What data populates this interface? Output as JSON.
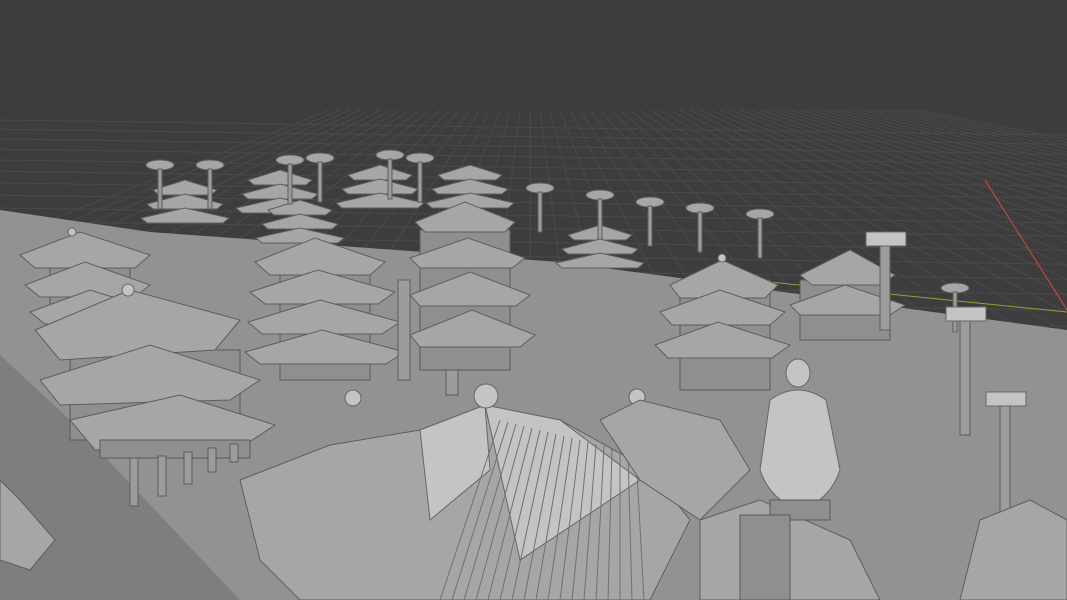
{
  "viewport": {
    "mode": "solid-shading",
    "background_color": "#3d3d3d",
    "grid_color": "#4a4a4a",
    "ground_color": "#929292",
    "model_color": "#a6a6a6",
    "x_axis_color": "#c0453f",
    "y_axis_color": "#8fa336"
  },
  "scene": {
    "subject": "ancient-chinese-architecture-complex",
    "objects": [
      "pagoda",
      "pavilion",
      "gate-archway",
      "statue",
      "tree",
      "pillar"
    ]
  }
}
